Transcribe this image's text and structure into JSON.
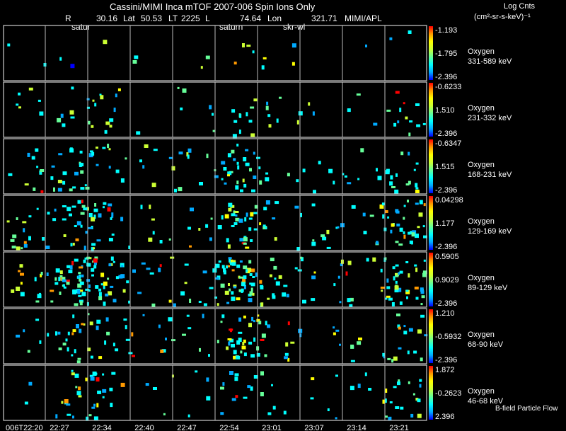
{
  "header": {
    "title": "Cassini/MIMI Inca mTOF  2007-006   Spin    Ions Only",
    "units_title": "Log Cnts",
    "units_sub": "(cm²-sr-s-keV)⁻¹",
    "ephem": [
      {
        "label": "R",
        "value": "30.16"
      },
      {
        "label": "Lat",
        "value": "50.53"
      },
      {
        "label": "LT",
        "value": "2225"
      },
      {
        "label": "L",
        "value": "74.64"
      },
      {
        "label": "Lon",
        "value": "321.71"
      }
    ],
    "credit": "MIMI/APL"
  },
  "overlay_labels": [
    "satur",
    "saturn",
    "skr-wl"
  ],
  "footer_note": "B-field Particle Flow",
  "chart_data": {
    "type": "heatmap",
    "x_ticks": [
      "006T22:20",
      "22:27",
      "22:34",
      "22:40",
      "22:47",
      "22:54",
      "23:01",
      "23:07",
      "23:14",
      "23:21"
    ],
    "colormap": [
      "#0000ff",
      "#00aaff",
      "#00ffff",
      "#66ff99",
      "#ccff33",
      "#ffff00",
      "#ff9900",
      "#ff0000"
    ],
    "panels": [
      {
        "species": "Oxygen",
        "energy": "331-589 keV",
        "cbar": [
          "-1.193",
          "-1.795",
          "-2.396"
        ]
      },
      {
        "species": "Oxygen",
        "energy": "231-332 keV",
        "cbar": [
          "-0.6233",
          "1.510",
          "-2.396"
        ]
      },
      {
        "species": "Oxygen",
        "energy": "168-231 keV",
        "cbar": [
          "-0.6347",
          "1.515",
          "-2.396"
        ]
      },
      {
        "species": "Oxygen",
        "energy": "129-169 keV",
        "cbar": [
          "0.04298",
          "1.177",
          "-2.396"
        ]
      },
      {
        "species": "Oxygen",
        "energy": "89-129 keV",
        "cbar": [
          "0.5905",
          "0.9029",
          "-2.396"
        ]
      },
      {
        "species": "Oxygen",
        "energy": "68-90 keV",
        "cbar": [
          "1.210",
          "-0.5932",
          "-2.396"
        ]
      },
      {
        "species": "Oxygen",
        "energy": "46-68 keV",
        "cbar": [
          "1.872",
          "-0.2623",
          "2.396"
        ]
      }
    ]
  }
}
